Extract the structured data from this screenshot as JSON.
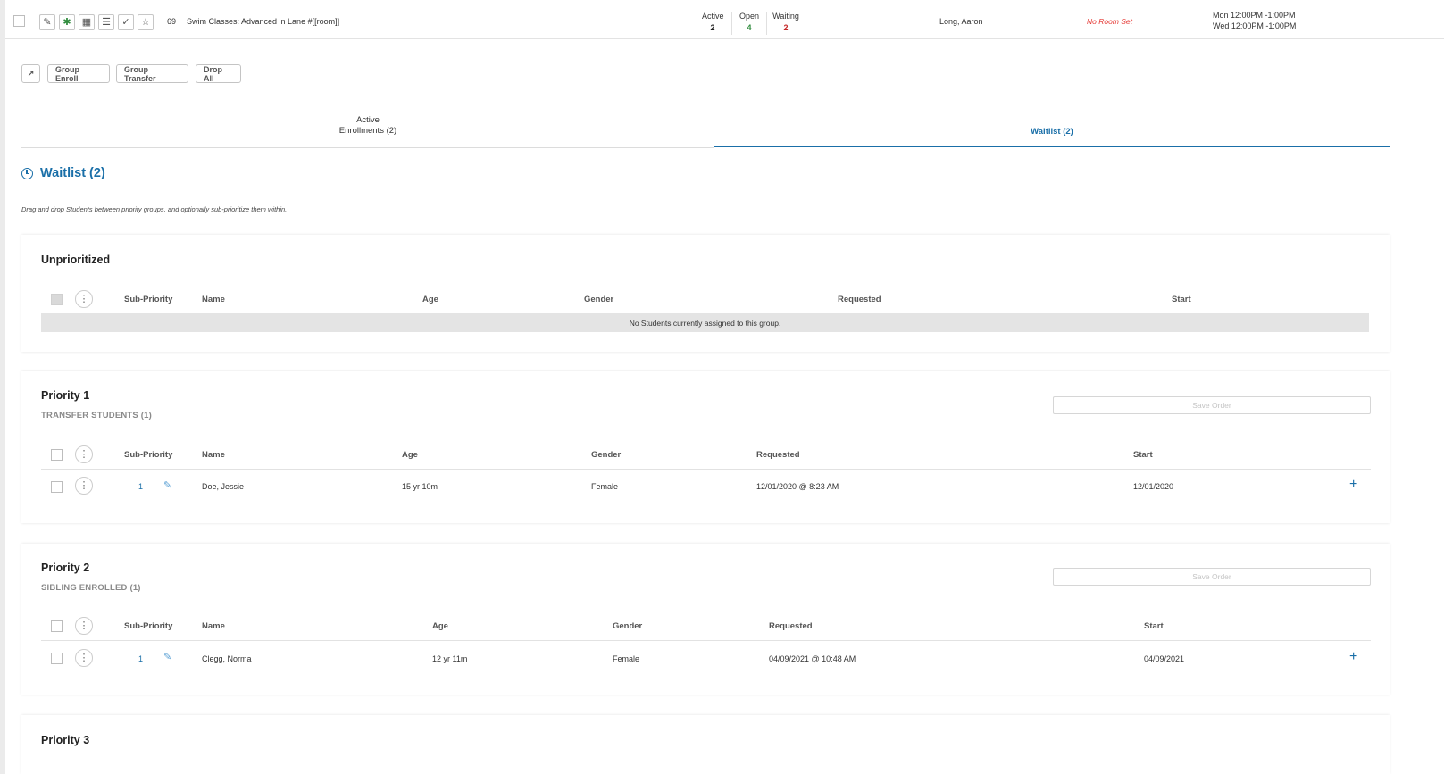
{
  "class_row": {
    "number": "69",
    "title": "Swim Classes: Advanced in Lane #[[room]]",
    "stats": [
      {
        "label": "Active",
        "value": "2",
        "color": "#222222"
      },
      {
        "label": "Open",
        "value": "4",
        "color": "#2e8b3c"
      },
      {
        "label": "Waiting",
        "value": "2",
        "color": "#c62828"
      }
    ],
    "instructor": "Long, Aaron",
    "room": "No Room Set",
    "schedule": [
      "Mon 12:00PM -1:00PM",
      "Wed 12:00PM -1:00PM"
    ],
    "icons": [
      "pencil-icon",
      "people-icon",
      "calendar-icon",
      "list-icon",
      "check-icon",
      "star-icon"
    ]
  },
  "toolbar": {
    "wand_icon": "magic-wand-icon",
    "buttons": [
      "Group Enroll",
      "Group Transfer",
      "Drop All"
    ]
  },
  "tabs": {
    "active_line1": "Active",
    "active_line2": "Enrollments (2)",
    "waitlist": "Waitlist (2)"
  },
  "waitlist": {
    "title": "Waitlist (2)",
    "description": "Drag and drop Students between priority groups, and optionally sub-prioritize them within."
  },
  "colors": {
    "accent": "#1a6fa8",
    "no_room": "#e53935"
  },
  "groups": [
    {
      "title": "Unprioritized",
      "subtitle": "",
      "headers": [
        "Sub-Priority",
        "Name",
        "Age",
        "Gender",
        "Requested",
        "Start"
      ],
      "empty_text": "No Students currently assigned to this group.",
      "rows": []
    },
    {
      "title": "Priority 1",
      "subtitle": "TRANSFER STUDENTS (1)",
      "save_label": "Save Order",
      "headers": [
        "Sub-Priority",
        "Name",
        "Age",
        "Gender",
        "Requested",
        "Start"
      ],
      "rows": [
        {
          "sub_priority": "1",
          "name": "Doe, Jessie",
          "age": "15 yr 10m",
          "gender": "Female",
          "requested": "12/01/2020 @ 8:23 AM",
          "start": "12/01/2020"
        }
      ]
    },
    {
      "title": "Priority 2",
      "subtitle": "SIBLING ENROLLED (1)",
      "save_label": "Save Order",
      "headers": [
        "Sub-Priority",
        "Name",
        "Age",
        "Gender",
        "Requested",
        "Start"
      ],
      "rows": [
        {
          "sub_priority": "1",
          "name": "Clegg, Norma",
          "age": "12 yr 11m",
          "gender": "Female",
          "requested": "04/09/2021 @ 10:48 AM",
          "start": "04/09/2021"
        }
      ]
    },
    {
      "title": "Priority 3"
    }
  ]
}
